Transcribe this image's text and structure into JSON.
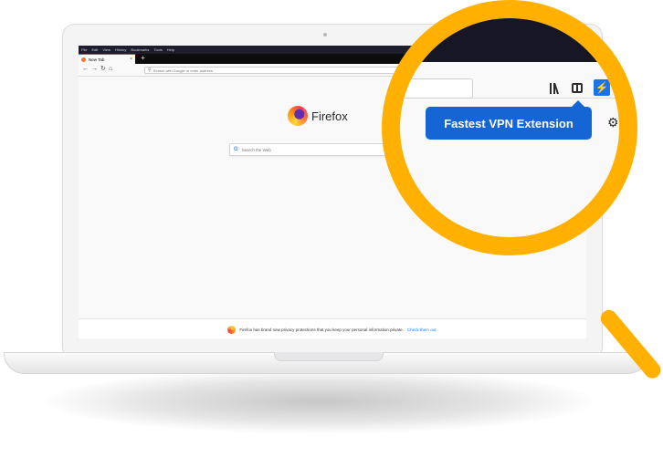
{
  "browser": {
    "menu_items": [
      "File",
      "Edit",
      "View",
      "History",
      "Bookmarks",
      "Tools",
      "Help"
    ],
    "tab_title": "New Tab",
    "tab_close": "×",
    "new_tab": "+",
    "nav": {
      "back": "←",
      "forward": "→",
      "reload": "↻",
      "home": "⌂"
    },
    "url_placeholder": "Search with Google or enter address"
  },
  "newtab_page": {
    "brand": "Firefox",
    "search_placeholder": "Search the Web",
    "settings_icon": "⚙",
    "footer_text": "Firefox has brand new privacy protections that you keep your personal information private.",
    "footer_link": "Check them out."
  },
  "magnifier": {
    "tooltip": "Fastest VPN Extension",
    "extension_glyph": "⚡",
    "settings_icon": "⚙"
  },
  "colors": {
    "accent_blue": "#1566d4",
    "magnifier_yellow": "#ffb000",
    "titlebar_dark": "#1d1d2e"
  }
}
